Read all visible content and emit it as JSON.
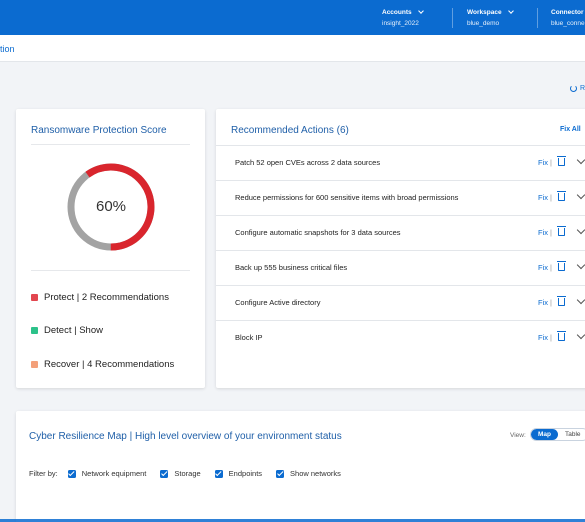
{
  "header": {
    "accounts": {
      "label": "Accounts",
      "value": "insight_2022"
    },
    "workspace": {
      "label": "Workspace",
      "value": "blue_demo"
    },
    "connector": {
      "label": "Connector",
      "value": "blue_conne"
    }
  },
  "subheader": {
    "breadcrumb": "tion"
  },
  "refresh_label": "R",
  "score": {
    "title": "Ransomware Protection Score",
    "percent_label": "60%",
    "percent": 60,
    "legend": [
      {
        "label": "Protect | 2 Recommendations",
        "color": "#e2464f"
      },
      {
        "label": "Detect | Show",
        "color": "#2cc28a"
      },
      {
        "label": "Recover | 4 Recommendations",
        "color": "#f3a07a"
      }
    ]
  },
  "actions": {
    "title": "Recommended Actions (6)",
    "fix_all": "Fix All",
    "fix_label": "Fix",
    "separator": "|",
    "items": [
      "Patch 52 open CVEs across 2 data sources",
      "Reduce permissions for 600 sensitive items with broad permissions",
      "Configure automatic snapshots for 3 data sources",
      "Back up 555 business critical files",
      "Configure Active directory",
      "Block IP"
    ]
  },
  "map": {
    "title": "Cyber Resilience Map | High level overview of your environment status",
    "view_label": "View:",
    "view_options": [
      "Map",
      "Table"
    ],
    "filter_label": "Filter by:",
    "filters": [
      "Network equipment",
      "Storage",
      "Endpoints",
      "Show networks"
    ]
  },
  "colors": {
    "accent": "#0b6bd0",
    "donut_red": "#d9252d",
    "donut_gray": "#a3a3a3"
  }
}
